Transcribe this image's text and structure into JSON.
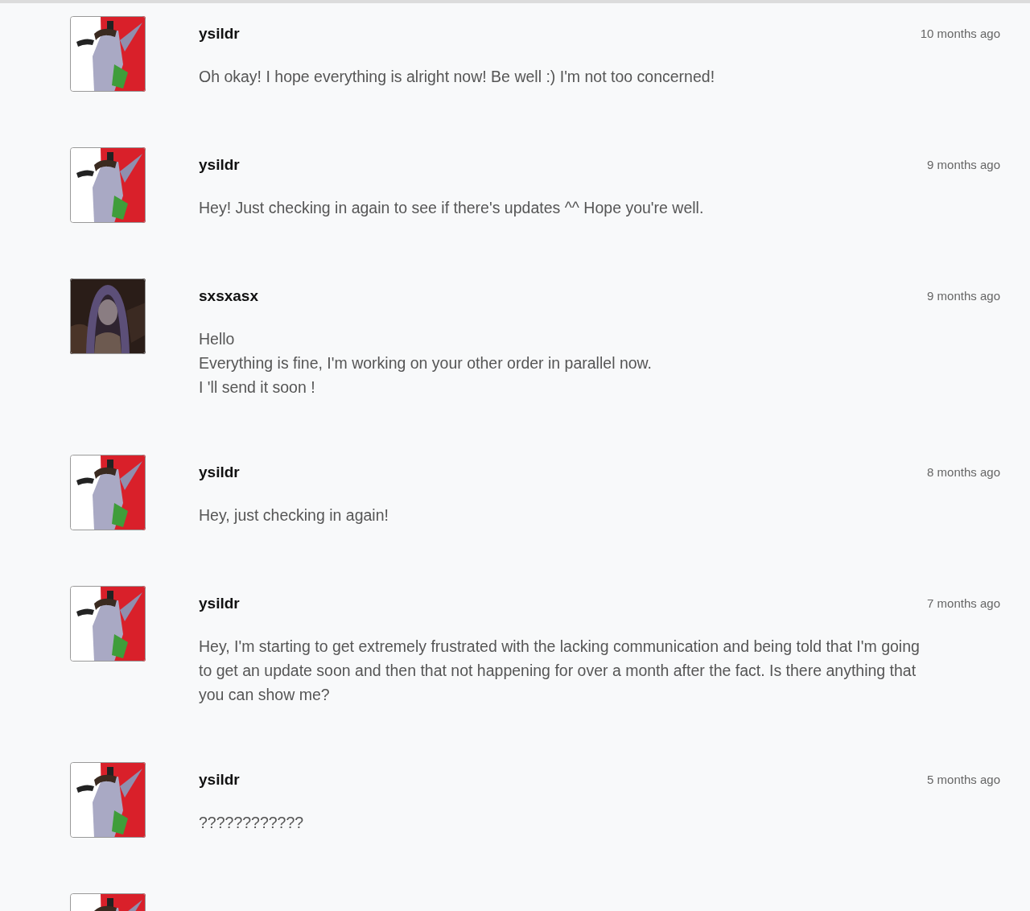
{
  "messages": [
    {
      "kind": "message",
      "user": "ysildr",
      "time": "10 months ago",
      "text": "Oh okay! I hope everything is alright now! Be well :) I'm not too concerned!"
    },
    {
      "kind": "message",
      "user": "ysildr",
      "time": "9 months ago",
      "text": "Hey! Just checking in again to see if there's updates  ^^ Hope you're well."
    },
    {
      "kind": "message",
      "user": "sxsxasx",
      "time": "9 months ago",
      "text": "Hello\nEverything is fine, I'm working on your other order in parallel now.\nI 'll send it soon !"
    },
    {
      "kind": "message",
      "user": "ysildr",
      "time": "8 months ago",
      "text": "Hey, just checking in again!"
    },
    {
      "kind": "message",
      "user": "ysildr",
      "time": "7 months ago",
      "text": "Hey, I'm starting to get extremely frustrated with the lacking communication and being told that I'm going to get an update soon and then that not happening for over a month after the fact. Is there anything that you can show me?"
    },
    {
      "kind": "message",
      "user": "ysildr",
      "time": "5 months ago",
      "text": "????????????"
    },
    {
      "kind": "avatar_only"
    }
  ]
}
